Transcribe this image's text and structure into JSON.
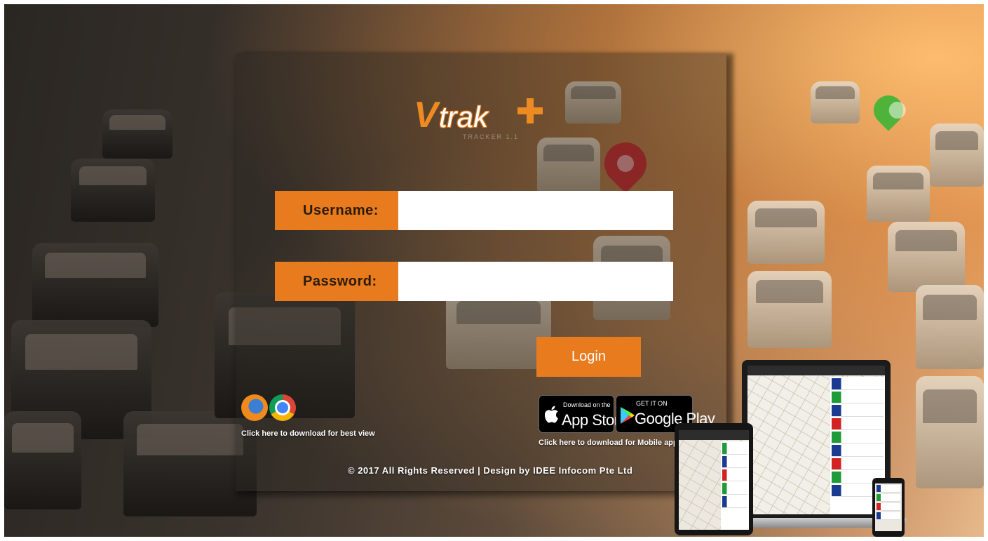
{
  "brand": {
    "logo_v": "V",
    "logo_trak": "trak",
    "logo_sub": "TRACKER 1.1"
  },
  "login_form": {
    "username_label": "Username:",
    "username_value": "",
    "password_label": "Password:",
    "password_value": "",
    "login_button": "Login"
  },
  "browsers": {
    "caption": "Click here to download for best view",
    "icons": [
      "firefox-icon",
      "chrome-icon"
    ]
  },
  "mobile_apps": {
    "app_store_small": "Download on the",
    "app_store_big": "App Store",
    "google_play_small": "GET IT ON",
    "google_play_big": "Google Play",
    "caption": "Click here to download for Mobile apps"
  },
  "footer": {
    "copyright": "© 2017 All Rights Reserved | Design by IDEE Infocom Pte Ltd"
  },
  "colors": {
    "accent": "#e87b1e",
    "map_pin_red": "#c8282a",
    "map_pin_green": "#4fb33a"
  }
}
